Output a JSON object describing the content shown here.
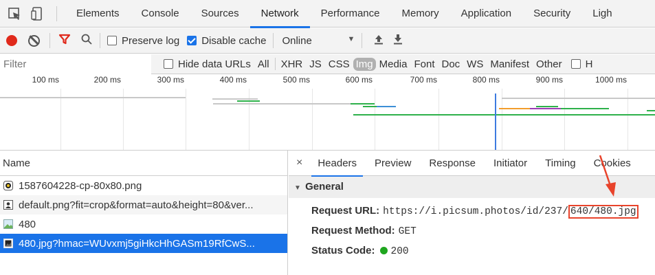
{
  "tabs": [
    "Elements",
    "Console",
    "Sources",
    "Network",
    "Performance",
    "Memory",
    "Application",
    "Security",
    "Ligh"
  ],
  "active_tab": "Network",
  "toolbar": {
    "preserve_log": "Preserve log",
    "disable_cache": "Disable cache",
    "throttle": "Online"
  },
  "filter": {
    "placeholder": "Filter",
    "hide_data_urls": "Hide data URLs",
    "types": [
      "All",
      "XHR",
      "JS",
      "CSS",
      "Img",
      "Media",
      "Font",
      "Doc",
      "WS",
      "Manifest",
      "Other"
    ],
    "selected_type": "Img"
  },
  "timeline": {
    "ticks": [
      "100 ms",
      "200 ms",
      "300 ms",
      "400 ms",
      "500 ms",
      "600 ms",
      "700 ms",
      "800 ms",
      "900 ms",
      "1000 ms"
    ]
  },
  "requests": {
    "column": "Name",
    "rows": [
      {
        "name": "1587604228-cp-80x80.png",
        "icon": "image-file-icon"
      },
      {
        "name": "default.png?fit=crop&format=auto&height=80&ver...",
        "icon": "image-file-icon"
      },
      {
        "name": "480",
        "icon": "image-thumbnail-icon"
      },
      {
        "name": "480.jpg?hmac=WUvxmj5giHkcHhGASm19RfCwS...",
        "icon": "image-file-icon"
      }
    ],
    "selected_index": 3
  },
  "details": {
    "close": "×",
    "tabs": [
      "Headers",
      "Preview",
      "Response",
      "Initiator",
      "Timing",
      "Cookies"
    ],
    "active_tab": "Headers",
    "section": "General",
    "request_url_label": "Request URL:",
    "request_url_prefix": "https://i.picsum.photos/id/237/",
    "request_url_highlight": "640/480.jpg",
    "request_method_label": "Request Method:",
    "request_method": "GET",
    "status_code_label": "Status Code:",
    "status_code": "200"
  },
  "colors": {
    "accent": "#1a73e8",
    "record": "#e0291b",
    "annotation": "#e8432b",
    "status_ok": "#1fa61f"
  }
}
